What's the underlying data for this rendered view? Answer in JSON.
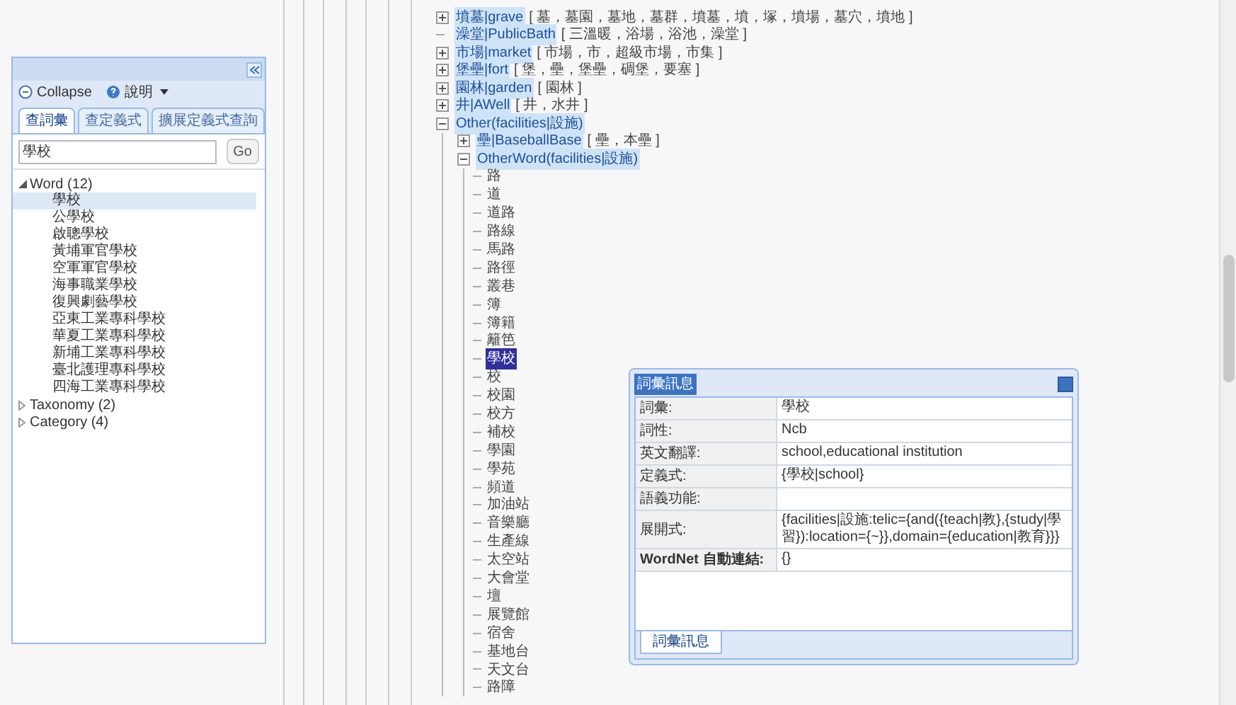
{
  "left_panel": {
    "collapse_label": "Collapse",
    "help_label": "說明",
    "tabs": [
      {
        "label": "查詞彙",
        "selected": true
      },
      {
        "label": "查定義式",
        "selected": false
      },
      {
        "label": "擴展定義式查詢",
        "selected": false
      }
    ],
    "search": {
      "value": "學校"
    },
    "go_button": "Go",
    "tree": [
      {
        "label": "Word (12)",
        "expanded": true,
        "children": [
          {
            "label": "學校",
            "selected": true
          },
          {
            "label": "公學校",
            "selected": false
          },
          {
            "label": "啟聰學校",
            "selected": false
          },
          {
            "label": "黃埔軍官學校",
            "selected": false
          },
          {
            "label": "空軍軍官學校",
            "selected": false
          },
          {
            "label": "海事職業學校",
            "selected": false
          },
          {
            "label": "復興劇藝學校",
            "selected": false
          },
          {
            "label": "亞東工業專科學校",
            "selected": false
          },
          {
            "label": "華夏工業專科學校",
            "selected": false
          },
          {
            "label": "新埔工業專科學校",
            "selected": false
          },
          {
            "label": "臺北護理專科學校",
            "selected": false
          },
          {
            "label": "四海工業專科學校",
            "selected": false
          }
        ]
      },
      {
        "label": "Taxonomy (2)",
        "expanded": false
      },
      {
        "label": "Category (4)",
        "expanded": false
      }
    ]
  },
  "main_tree": [
    {
      "kind": "node",
      "label": "墳墓|grave",
      "words": "[ 墓，墓園，墓地，墓群，墳墓，墳，塚，墳場，墓穴，墳地 ]",
      "expanded": false
    },
    {
      "kind": "leaf",
      "label": "澡堂|PublicBath",
      "words": "[ 三溫暖，浴場，浴池，澡堂 ]"
    },
    {
      "kind": "node",
      "label": "市場|market",
      "words": "[ 市場，市，超級市場，市集 ]",
      "expanded": false
    },
    {
      "kind": "node",
      "label": "堡壘|fort",
      "words": "[ 堡，壘，堡壘，碉堡，要塞 ]",
      "expanded": false
    },
    {
      "kind": "node",
      "label": "園林|garden",
      "words": "[ 園林 ]",
      "expanded": false
    },
    {
      "kind": "node",
      "label": "井|AWell",
      "words": "[ 井，水井 ]",
      "expanded": false
    },
    {
      "kind": "node",
      "label": "Other(facilities|設施)",
      "expanded": true,
      "children": [
        {
          "kind": "node",
          "label": "壘|BaseballBase",
          "words": "[ 壘，本壘 ]",
          "expanded": false
        },
        {
          "kind": "node",
          "label": "OtherWord(facilities|設施)",
          "expanded": true,
          "children": [
            {
              "kind": "word",
              "label": "路",
              "selected": false
            },
            {
              "kind": "word",
              "label": "道",
              "selected": false
            },
            {
              "kind": "word",
              "label": "道路",
              "selected": false
            },
            {
              "kind": "word",
              "label": "路線",
              "selected": false
            },
            {
              "kind": "word",
              "label": "馬路",
              "selected": false
            },
            {
              "kind": "word",
              "label": "路徑",
              "selected": false
            },
            {
              "kind": "word",
              "label": "叢巷",
              "selected": false
            },
            {
              "kind": "word",
              "label": "簿",
              "selected": false
            },
            {
              "kind": "word",
              "label": "簿籍",
              "selected": false
            },
            {
              "kind": "word",
              "label": "籬笆",
              "selected": false
            },
            {
              "kind": "word",
              "label": "學校",
              "selected": true
            },
            {
              "kind": "word",
              "label": "校",
              "selected": false
            },
            {
              "kind": "word",
              "label": "校園",
              "selected": false
            },
            {
              "kind": "word",
              "label": "校方",
              "selected": false
            },
            {
              "kind": "word",
              "label": "補校",
              "selected": false
            },
            {
              "kind": "word",
              "label": "學園",
              "selected": false
            },
            {
              "kind": "word",
              "label": "學苑",
              "selected": false
            },
            {
              "kind": "word",
              "label": "頻道",
              "selected": false
            },
            {
              "kind": "word",
              "label": "加油站",
              "selected": false
            },
            {
              "kind": "word",
              "label": "音樂廳",
              "selected": false
            },
            {
              "kind": "word",
              "label": "生產線",
              "selected": false
            },
            {
              "kind": "word",
              "label": "太空站",
              "selected": false
            },
            {
              "kind": "word",
              "label": "大會堂",
              "selected": false
            },
            {
              "kind": "word",
              "label": "壇",
              "selected": false
            },
            {
              "kind": "word",
              "label": "展覽館",
              "selected": false
            },
            {
              "kind": "word",
              "label": "宿舍",
              "selected": false
            },
            {
              "kind": "word",
              "label": "基地台",
              "selected": false
            },
            {
              "kind": "word",
              "label": "天文台",
              "selected": false
            },
            {
              "kind": "word",
              "label": "路障",
              "selected": false
            }
          ]
        }
      ]
    }
  ],
  "popup": {
    "title": "詞彙訊息",
    "rows": [
      {
        "label": "詞彙:",
        "value": "學校",
        "bold": false
      },
      {
        "label": "詞性:",
        "value": "Ncb",
        "bold": false
      },
      {
        "label": "英文翻譯:",
        "value": "school,educational institution",
        "bold": false
      },
      {
        "label": "定義式:",
        "value": "{學校|school}",
        "bold": false
      },
      {
        "label": "語義功能:",
        "bold": false
      },
      {
        "label": "展開式:",
        "value": "{facilities|設施:telic={and({teach|教},{study|學習}):location={~}},domain={education|教育}}}",
        "bold": false
      },
      {
        "label": "WordNet 自動連結:",
        "value": "{}",
        "bold": true
      }
    ],
    "tab": "詞彙訊息"
  }
}
